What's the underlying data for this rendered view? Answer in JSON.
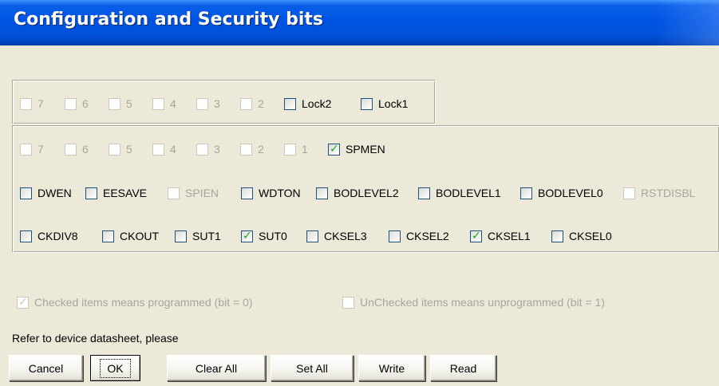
{
  "window": {
    "title": "Configuration and Security bits"
  },
  "lock_bits": [
    {
      "label": "7",
      "checked": false,
      "enabled": false
    },
    {
      "label": "6",
      "checked": false,
      "enabled": false
    },
    {
      "label": "5",
      "checked": false,
      "enabled": false
    },
    {
      "label": "4",
      "checked": false,
      "enabled": false
    },
    {
      "label": "3",
      "checked": false,
      "enabled": false
    },
    {
      "label": "2",
      "checked": false,
      "enabled": false
    },
    {
      "label": "Lock2",
      "checked": false,
      "enabled": true
    },
    {
      "label": "Lock1",
      "checked": false,
      "enabled": true
    }
  ],
  "extended_fuse": [
    {
      "label": "7",
      "checked": false,
      "enabled": false
    },
    {
      "label": "6",
      "checked": false,
      "enabled": false
    },
    {
      "label": "5",
      "checked": false,
      "enabled": false
    },
    {
      "label": "4",
      "checked": false,
      "enabled": false
    },
    {
      "label": "3",
      "checked": false,
      "enabled": false
    },
    {
      "label": "2",
      "checked": false,
      "enabled": false
    },
    {
      "label": "1",
      "checked": false,
      "enabled": false
    },
    {
      "label": "SPMEN",
      "checked": true,
      "enabled": true
    }
  ],
  "high_fuse": [
    {
      "label": "DWEN",
      "checked": false,
      "enabled": true
    },
    {
      "label": "EESAVE",
      "checked": false,
      "enabled": true
    },
    {
      "label": "SPIEN",
      "checked": false,
      "enabled": false
    },
    {
      "label": "WDTON",
      "checked": false,
      "enabled": true
    },
    {
      "label": "BODLEVEL2",
      "checked": false,
      "enabled": true
    },
    {
      "label": "BODLEVEL1",
      "checked": false,
      "enabled": true
    },
    {
      "label": "BODLEVEL0",
      "checked": false,
      "enabled": true
    },
    {
      "label": "RSTDISBL",
      "checked": false,
      "enabled": false
    }
  ],
  "low_fuse": [
    {
      "label": "CKDIV8",
      "checked": false,
      "enabled": true
    },
    {
      "label": "CKOUT",
      "checked": false,
      "enabled": true
    },
    {
      "label": "SUT1",
      "checked": false,
      "enabled": true
    },
    {
      "label": "SUT0",
      "checked": true,
      "enabled": true
    },
    {
      "label": "CKSEL3",
      "checked": false,
      "enabled": true
    },
    {
      "label": "CKSEL2",
      "checked": false,
      "enabled": true
    },
    {
      "label": "CKSEL1",
      "checked": true,
      "enabled": true
    },
    {
      "label": "CKSEL0",
      "checked": false,
      "enabled": true
    }
  ],
  "legend": {
    "checked_text": "Checked items means programmed (bit = 0)",
    "unchecked_text": "UnChecked items means unprogrammed (bit = 1)"
  },
  "note": "Refer to device datasheet, please",
  "buttons": {
    "cancel": "Cancel",
    "ok": "OK",
    "clear_all": "Clear All",
    "set_all": "Set All",
    "write": "Write",
    "read": "Read"
  },
  "colors": {
    "titlebar": "#0054e3",
    "dialog_bg": "#ece9d8",
    "check_mark": "#21a121",
    "disabled_text": "#a7a69b"
  }
}
